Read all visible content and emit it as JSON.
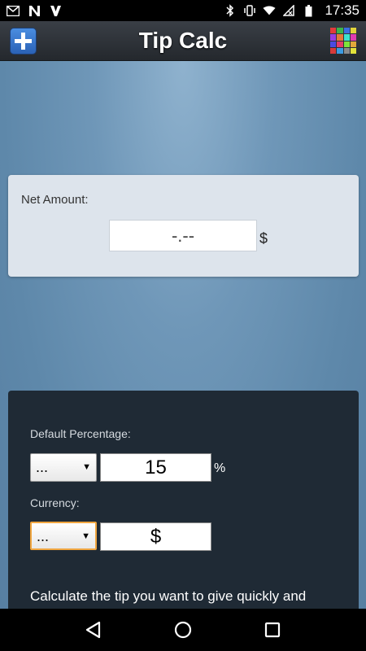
{
  "status_bar": {
    "time": "17:35",
    "left_icons": [
      "gmail-icon",
      "n-notification-icon",
      "v-notification-icon"
    ],
    "right_icons": [
      "bluetooth-icon",
      "vibrate-icon",
      "wifi-icon",
      "no-signal-icon",
      "battery-icon"
    ]
  },
  "app_bar": {
    "title": "Tip Calc",
    "left_button_icon": "add-icon",
    "right_button_icon": "color-grid-icon",
    "grid_colors": [
      "#e23b3b",
      "#3bb54a",
      "#3b6fe2",
      "#e2d43b",
      "#9b3be2",
      "#e27a3b",
      "#3be2d0",
      "#e23bb0",
      "#4a4ae2",
      "#e23b6a",
      "#7de23b",
      "#e2a83b",
      "#d63b3b",
      "#3b9be2",
      "#8a8a8a",
      "#e2e23b"
    ]
  },
  "net_amount": {
    "label": "Net Amount:",
    "value": "-.--",
    "currency": "$"
  },
  "settings": {
    "percentage_label": "Default Percentage:",
    "percentage_select": "...",
    "percentage_value": "15",
    "percentage_sign": "%",
    "currency_label": "Currency:",
    "currency_select": "...",
    "currency_value": "$",
    "description": "Calculate the tip you want to give quickly and easily. Enter the"
  },
  "nav_bar": {
    "icons": [
      "back-icon",
      "home-icon",
      "recents-icon"
    ]
  },
  "colors": {
    "background": "#6a93b4",
    "panel": "#1f2a35",
    "card": "#dde4ec",
    "focus": "#f0a640"
  }
}
